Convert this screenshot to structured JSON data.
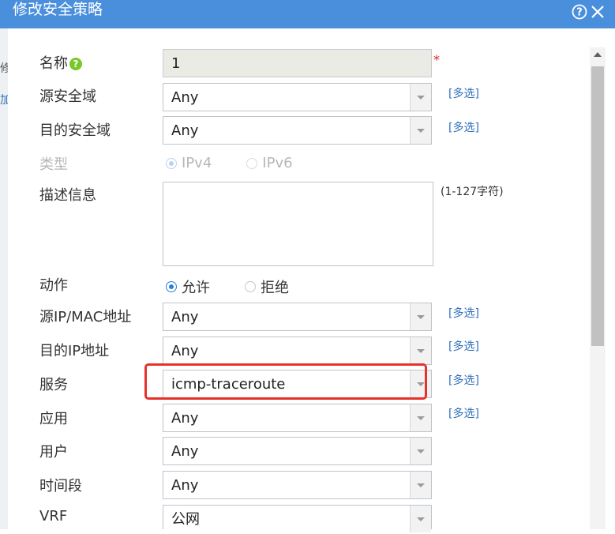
{
  "dialog": {
    "title": "修改安全策略",
    "help_symbol": "?",
    "close_symbol": "✕"
  },
  "background": {
    "fragment_1": "修",
    "fragment_2": "加"
  },
  "form": {
    "name": {
      "label": "名称",
      "help": "?",
      "value": "1",
      "required_mark": "*"
    },
    "src_zone": {
      "label": "源安全域",
      "value": "Any",
      "multi": "[多选]"
    },
    "dst_zone": {
      "label": "目的安全域",
      "value": "Any",
      "multi": "[多选]"
    },
    "type": {
      "label": "类型",
      "options": [
        "IPv4",
        "IPv6"
      ],
      "selected": "IPv4"
    },
    "description": {
      "label": "描述信息",
      "hint": "(1-127字符)",
      "value": ""
    },
    "action": {
      "label": "动作",
      "options": [
        "允许",
        "拒绝"
      ],
      "selected": "允许"
    },
    "src_addr": {
      "label": "源IP/MAC地址",
      "value": "Any",
      "multi": "[多选]"
    },
    "dst_addr": {
      "label": "目的IP地址",
      "value": "Any",
      "multi": "[多选]"
    },
    "service": {
      "label": "服务",
      "value": "icmp-traceroute",
      "multi": "[多选]"
    },
    "application": {
      "label": "应用",
      "value": "Any",
      "multi": "[多选]"
    },
    "user": {
      "label": "用户",
      "value": "Any"
    },
    "time_range": {
      "label": "时间段",
      "value": "Any"
    },
    "vrf": {
      "label": "VRF",
      "value": "公网"
    }
  },
  "colors": {
    "titlebar": "#4a8fdc",
    "link": "#2f6fb8",
    "highlight": "#e8312a",
    "radio_checked": "#2a7ed6"
  }
}
